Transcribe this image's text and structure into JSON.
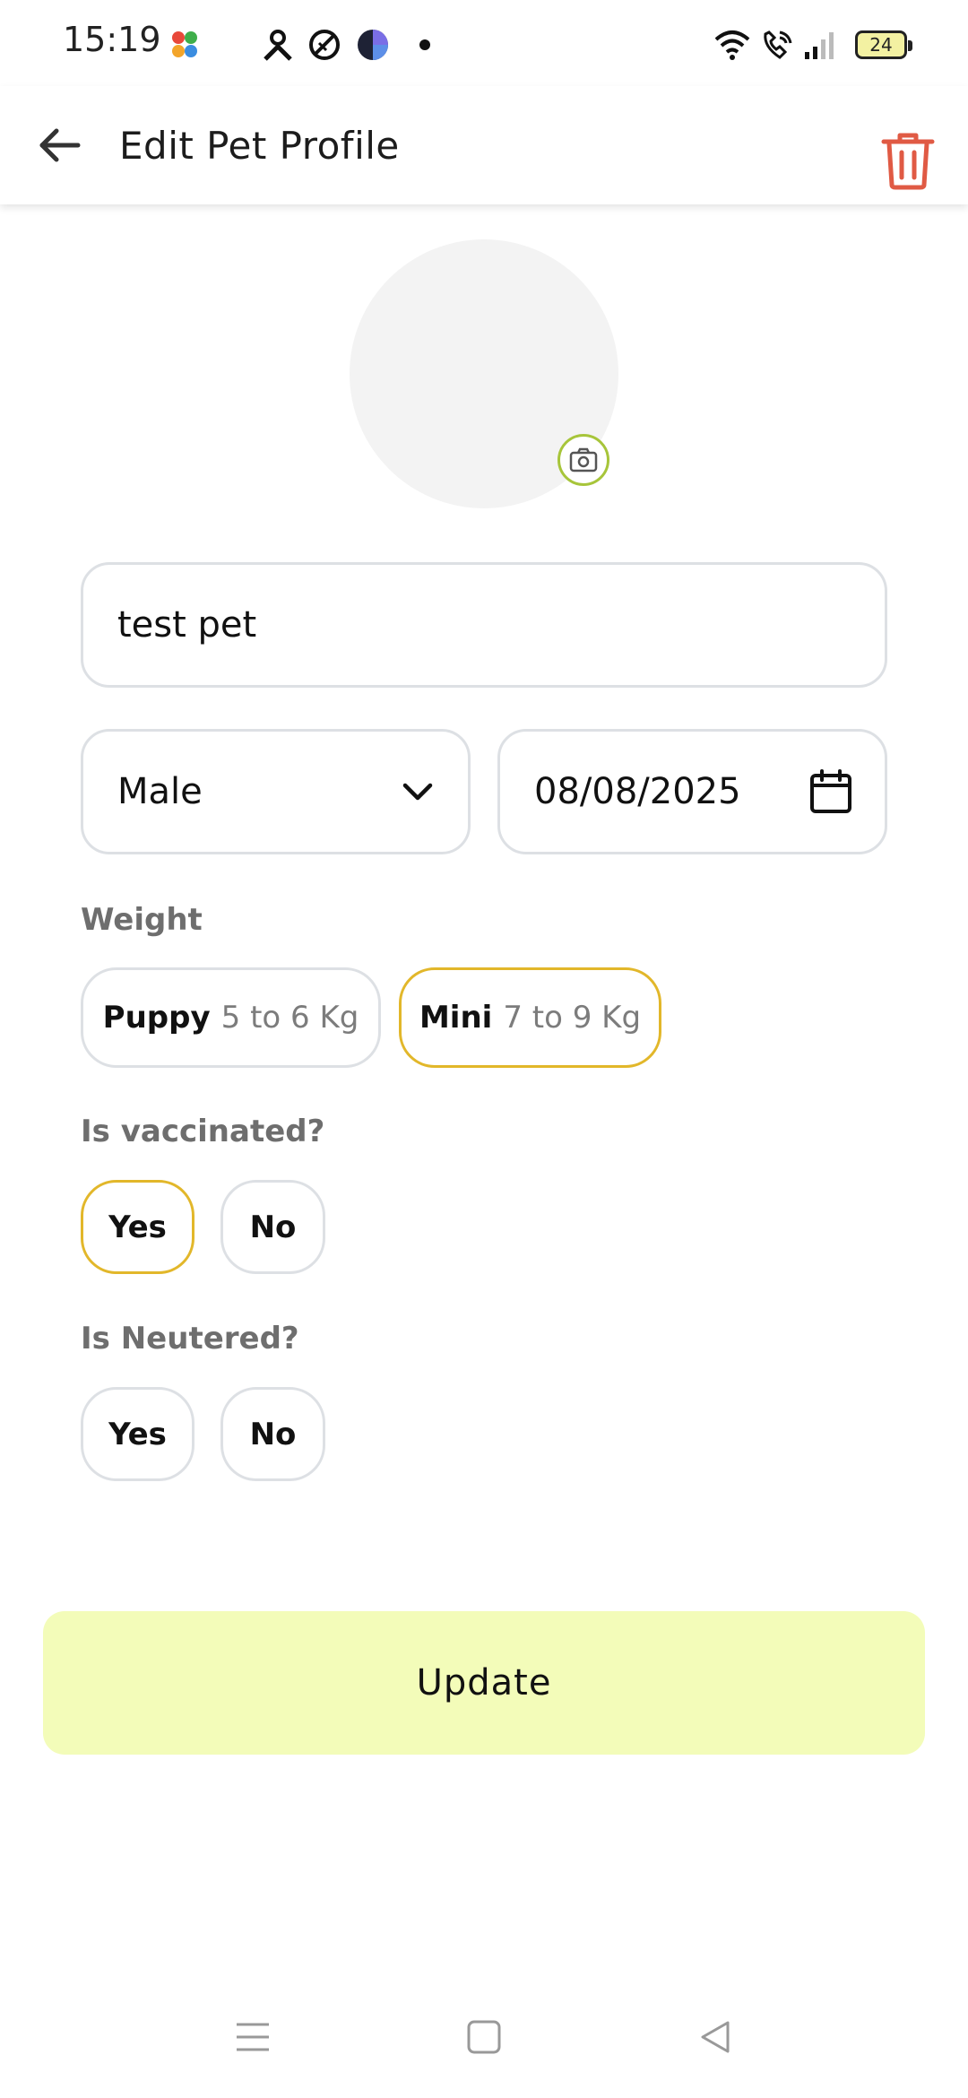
{
  "status_bar": {
    "time": "15:19",
    "battery": "24",
    "icons_left": [
      "app-launcher-icon",
      "person-app-icon",
      "shield-slash-icon",
      "pie-app-icon",
      "dot-icon"
    ],
    "icons_right": [
      "wifi-icon",
      "wifi-call-icon",
      "signal-icon",
      "battery-icon"
    ]
  },
  "app_bar": {
    "title": "Edit Pet Profile",
    "back_icon": "arrow-left-icon",
    "delete_icon": "trash-icon",
    "delete_color": "#e05a44"
  },
  "avatar": {
    "camera_icon": "camera-icon",
    "accent": "#a7c53a"
  },
  "form": {
    "name_value": "test pet",
    "gender_value": "Male",
    "birthdate_value": "08/08/2025",
    "weight_label": "Weight",
    "weight_options": [
      {
        "name": "Puppy",
        "range": "5 to 6 Kg",
        "selected": false
      },
      {
        "name": "Mini",
        "range": "7 to 9 Kg",
        "selected": true
      }
    ],
    "vaccinated_label": "Is vaccinated?",
    "vaccinated_options": [
      {
        "label": "Yes",
        "selected": true
      },
      {
        "label": "No",
        "selected": false
      }
    ],
    "neutered_label": "Is Neutered?",
    "neutered_options": [
      {
        "label": "Yes",
        "selected": false
      },
      {
        "label": "No",
        "selected": false
      }
    ],
    "selected_color": "#e2b72a"
  },
  "update_button": {
    "label": "Update",
    "background": "#f3fcb9"
  },
  "nav_bar": {
    "icons": [
      "menu-icon",
      "home-square-icon",
      "back-triangle-icon"
    ]
  }
}
